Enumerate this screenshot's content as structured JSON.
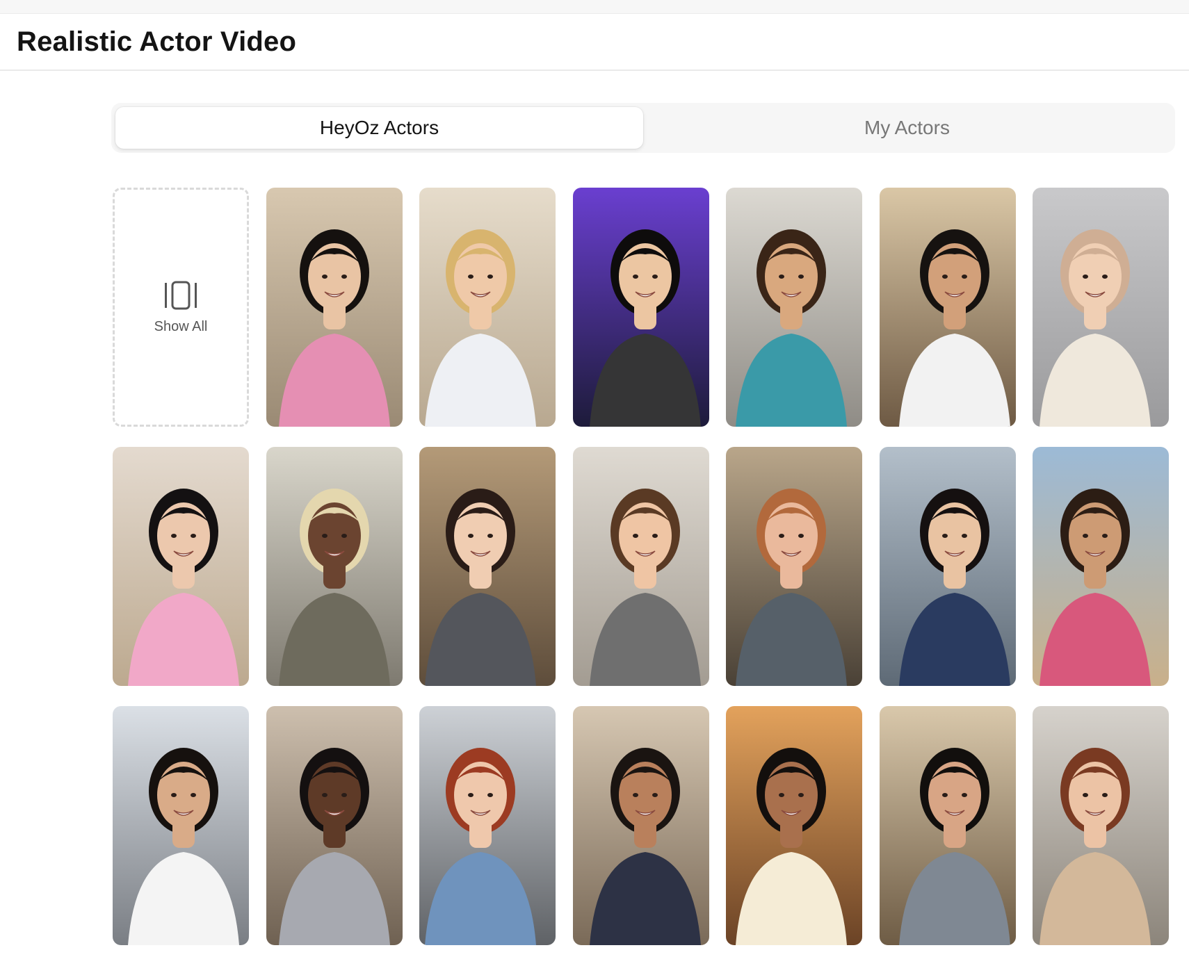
{
  "header": {
    "title": "Realistic Actor Video"
  },
  "tabs": [
    {
      "label": "HeyOz Actors",
      "active": true
    },
    {
      "label": "My Actors",
      "active": false
    }
  ],
  "show_all": {
    "label": "Show All",
    "icon": "carousel-icon"
  },
  "actors": [
    {
      "bg1": "#d8c8b0",
      "bg2": "#9a8a74",
      "skin": "#e9c4a4",
      "hair": "#15110f",
      "shirt": "#e58fb3"
    },
    {
      "bg1": "#e6dccb",
      "bg2": "#b8a890",
      "skin": "#efc9a8",
      "hair": "#d8b46e",
      "shirt": "#eef0f4"
    },
    {
      "bg1": "#6a3fd0",
      "bg2": "#1d1b3a",
      "skin": "#ecc6a2",
      "hair": "#0e0c0c",
      "shirt": "#353536"
    },
    {
      "bg1": "#dcd9d2",
      "bg2": "#8f8c86",
      "skin": "#d9a87e",
      "hair": "#3a2517",
      "shirt": "#3a9aa8"
    },
    {
      "bg1": "#dac7a6",
      "bg2": "#6e5a44",
      "skin": "#d2a07a",
      "hair": "#161210",
      "shirt": "#f2f2f2"
    },
    {
      "bg1": "#c9c9cb",
      "bg2": "#9a9a9c",
      "skin": "#f0cfb4",
      "hair": "#cfae94",
      "shirt": "#efe8dc"
    },
    {
      "bg1": "#e4dacf",
      "bg2": "#bca98f",
      "skin": "#ecc8ad",
      "hair": "#141112",
      "shirt": "#f1a8c8"
    },
    {
      "bg1": "#d9d6cb",
      "bg2": "#7e7a70",
      "skin": "#6b4430",
      "hair": "#e4d7ae",
      "shirt": "#6e6b5d"
    },
    {
      "bg1": "#b49a78",
      "bg2": "#5e4d3b",
      "skin": "#f0cdb2",
      "hair": "#2a1c17",
      "shirt": "#54565c"
    },
    {
      "bg1": "#dfdad2",
      "bg2": "#a39c92",
      "skin": "#efc5a4",
      "hair": "#5a3a24",
      "shirt": "#6f6f6f"
    },
    {
      "bg1": "#b9a68a",
      "bg2": "#4a4136",
      "skin": "#eab99c",
      "hair": "#b2693c",
      "shirt": "#566069"
    },
    {
      "bg1": "#b3bfca",
      "bg2": "#5e6a76",
      "skin": "#e9c3a2",
      "hair": "#151010",
      "shirt": "#2a3b60"
    },
    {
      "bg1": "#9cbad6",
      "bg2": "#c9b08a",
      "skin": "#cd9b74",
      "hair": "#2c1d14",
      "shirt": "#d8587c"
    },
    {
      "bg1": "#dbe0e6",
      "bg2": "#7a7e84",
      "skin": "#d9ab88",
      "hair": "#16110e",
      "shirt": "#f4f4f4"
    },
    {
      "bg1": "#cdbfae",
      "bg2": "#6f6152",
      "skin": "#5e3a27",
      "hair": "#141010",
      "shirt": "#a7a9b0"
    },
    {
      "bg1": "#cdd1d6",
      "bg2": "#5f6266",
      "skin": "#efc8ac",
      "hair": "#9c3b22",
      "shirt": "#6f93bd"
    },
    {
      "bg1": "#d6c7b2",
      "bg2": "#7a6a58",
      "skin": "#b9805c",
      "hair": "#1a1411",
      "shirt": "#2d3245"
    },
    {
      "bg1": "#e3a25c",
      "bg2": "#6b4326",
      "skin": "#a9704d",
      "hair": "#130f0d",
      "shirt": "#f5ecd6"
    },
    {
      "bg1": "#d9c8ab",
      "bg2": "#6e5c45",
      "skin": "#d8a585",
      "hair": "#120f0d",
      "shirt": "#7f8893"
    },
    {
      "bg1": "#d6d2cc",
      "bg2": "#8c857b",
      "skin": "#ecc3a5",
      "hair": "#7a3a22",
      "shirt": "#d3b89a"
    }
  ]
}
